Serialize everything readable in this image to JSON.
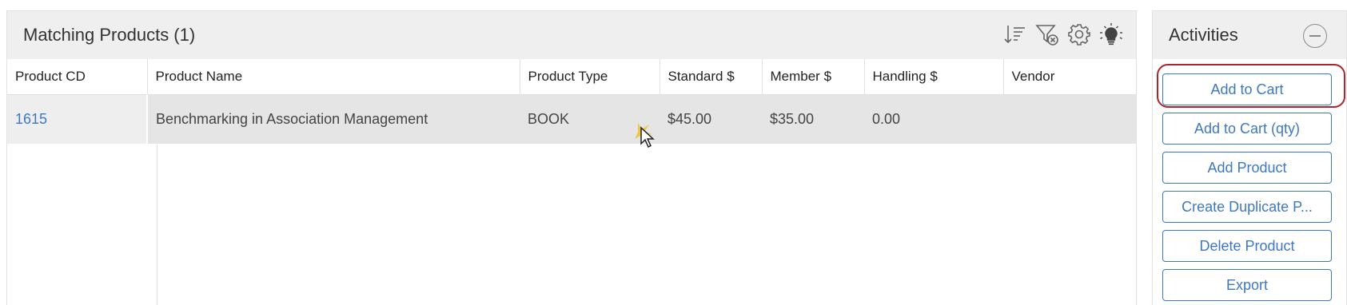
{
  "products": {
    "title": "Matching Products (1)",
    "toolbar_icons": [
      "sort-icon",
      "filter-clear-icon",
      "settings-gear-icon",
      "lightbulb-icon"
    ],
    "columns": [
      "Product CD",
      "Product Name",
      "Product Type",
      "Standard $",
      "Member $",
      "Handling $",
      "Vendor"
    ],
    "rows": [
      {
        "product_cd": "1615",
        "product_name": "Benchmarking in Association Management",
        "product_type": "BOOK",
        "standard": "$45.00",
        "member": "$35.00",
        "handling": "0.00",
        "vendor": ""
      }
    ]
  },
  "activities": {
    "title": "Activities",
    "buttons": [
      "Add to Cart",
      "Add to Cart (qty)",
      "Add Product",
      "Create Duplicate P...",
      "Delete Product",
      "Export"
    ]
  },
  "colors": {
    "link": "#3d78c4",
    "highlight": "#b0232a",
    "header_bg": "#efefef",
    "row_bg": "#e5e5e5"
  }
}
